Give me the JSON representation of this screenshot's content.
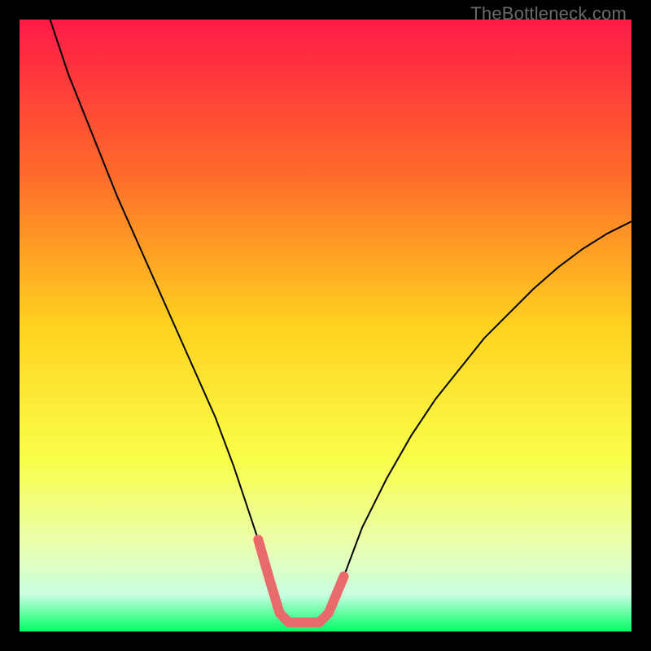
{
  "watermark": "TheBottleneck.com",
  "chart_data": {
    "type": "line",
    "title": "",
    "xlabel": "",
    "ylabel": "",
    "xlim": [
      0,
      100
    ],
    "ylim": [
      0,
      100
    ],
    "gradient_stops": [
      {
        "offset": 0,
        "color": "#ff1a47"
      },
      {
        "offset": 25,
        "color": "#ff6a2a"
      },
      {
        "offset": 50,
        "color": "#ffd21f"
      },
      {
        "offset": 72,
        "color": "#f9ff4a"
      },
      {
        "offset": 86,
        "color": "#eaffb0"
      },
      {
        "offset": 94,
        "color": "#c9ffe0"
      },
      {
        "offset": 100,
        "color": "#00ff66"
      }
    ],
    "series": [
      {
        "name": "bottleneck-curve",
        "color": "#000000",
        "stroke_width": 2,
        "x": [
          5,
          8,
          12,
          16,
          20,
          24,
          28,
          32,
          35,
          37,
          39,
          41,
          42.5,
          44,
          49,
          50.5,
          53,
          56,
          60,
          64,
          68,
          72,
          76,
          80,
          84,
          88,
          92,
          96,
          100
        ],
        "values": [
          100,
          91,
          81,
          71,
          62,
          53,
          44,
          35,
          27,
          21,
          15,
          8,
          3,
          1.5,
          1.5,
          3,
          9,
          17,
          25,
          32,
          38,
          43,
          48,
          52,
          56,
          59.5,
          62.5,
          65,
          67
        ]
      },
      {
        "name": "optimal-band",
        "color": "#e86a6a",
        "stroke_width": 12,
        "linecap": "round",
        "x": [
          39,
          41,
          42.5,
          44,
          49,
          50.5,
          53
        ],
        "values": [
          15,
          8,
          3,
          1.5,
          1.5,
          3,
          9
        ]
      }
    ]
  }
}
